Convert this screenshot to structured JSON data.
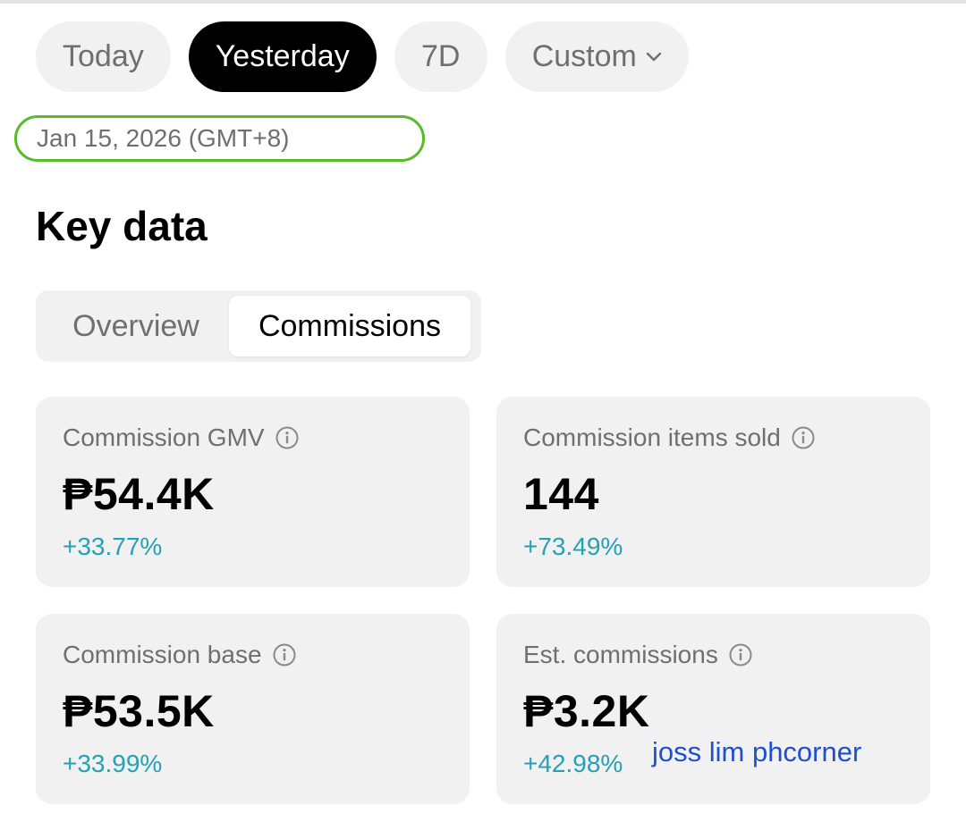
{
  "period_tabs": [
    {
      "label": "Today",
      "active": false
    },
    {
      "label": "Yesterday",
      "active": true
    },
    {
      "label": "7D",
      "active": false
    },
    {
      "label": "Custom",
      "active": false,
      "icon": "chevron-down-icon"
    }
  ],
  "date_range": "Jan 15, 2026 (GMT+8)",
  "section_title": "Key data",
  "view_tabs": [
    {
      "label": "Overview",
      "active": false
    },
    {
      "label": "Commissions",
      "active": true
    }
  ],
  "metrics": [
    {
      "label": "Commission GMV",
      "value": "₱54.4K",
      "change": "+33.77%",
      "icon": "info-icon"
    },
    {
      "label": "Commission items sold",
      "value": "144",
      "change": "+73.49%",
      "icon": "info-icon"
    },
    {
      "label": "Commission base",
      "value": "₱53.5K",
      "change": "+33.99%",
      "icon": "info-icon"
    },
    {
      "label": "Est. commissions",
      "value": "₱3.2K",
      "change": "+42.98%",
      "icon": "info-icon"
    }
  ],
  "watermark": "joss lim phcorner",
  "colors": {
    "accent_change": "#24a1b4",
    "date_outline": "#58bb2a",
    "active_pill": "#000000",
    "watermark": "#1f4fd1"
  }
}
